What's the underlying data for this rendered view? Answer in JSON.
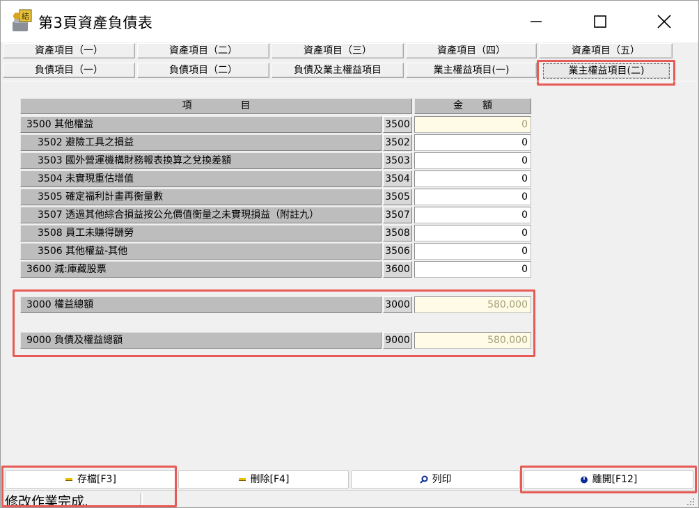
{
  "window": {
    "title": "第3頁資產負債表"
  },
  "tabs": [
    {
      "label": "資產項目（一）"
    },
    {
      "label": "資產項目（二）"
    },
    {
      "label": "資產項目（三）"
    },
    {
      "label": "資產項目（四）"
    },
    {
      "label": "資產項目（五）"
    },
    {
      "label": "負債項目（一）"
    },
    {
      "label": "負債項目（二）"
    },
    {
      "label": "負債及業主權益項目"
    },
    {
      "label": "業主權益項目(一)"
    },
    {
      "label": "業主權益項目(二)",
      "active": true
    }
  ],
  "table": {
    "header_item": "項　　　　　目",
    "header_amount": "金　　額",
    "rows": [
      {
        "label": "3500 其他權益",
        "code": "3500",
        "value": "0",
        "readonly": true
      },
      {
        "label": "3502 避險工具之損益",
        "code": "3502",
        "value": "0"
      },
      {
        "label": "3503 國外營運機構財務報表換算之兌換差額",
        "code": "3503",
        "value": "0"
      },
      {
        "label": "3504 未實現重估增值",
        "code": "3504",
        "value": "0"
      },
      {
        "label": "3505 確定福利計畫再衡量數",
        "code": "3505",
        "value": "0"
      },
      {
        "label": "3507 透過其他綜合損益按公允價值衡量之未實現損益（附註九）",
        "code": "3507",
        "value": "0"
      },
      {
        "label": "3508 員工未賺得酬勞",
        "code": "3508",
        "value": "0"
      },
      {
        "label": "3506 其他權益-其他",
        "code": "3506",
        "value": "0"
      },
      {
        "label": "3600 減:庫藏股票",
        "code": "3600",
        "value": "0"
      }
    ],
    "totals": [
      {
        "label": "3000 權益總額",
        "code": "3000",
        "value": "580,000"
      },
      {
        "label": "9000 負債及權益總額",
        "code": "9000",
        "value": "580,000"
      }
    ]
  },
  "buttons": {
    "save": "存檔[F3]",
    "delete": "刪除[F4]",
    "print": "列印",
    "exit": "離開[F12]"
  },
  "status": {
    "text": "修改作業完成."
  },
  "colors": {
    "highlight": "#e85a55",
    "readonly_bg": "#fffbe6",
    "label_bg": "#bdbdbd"
  }
}
